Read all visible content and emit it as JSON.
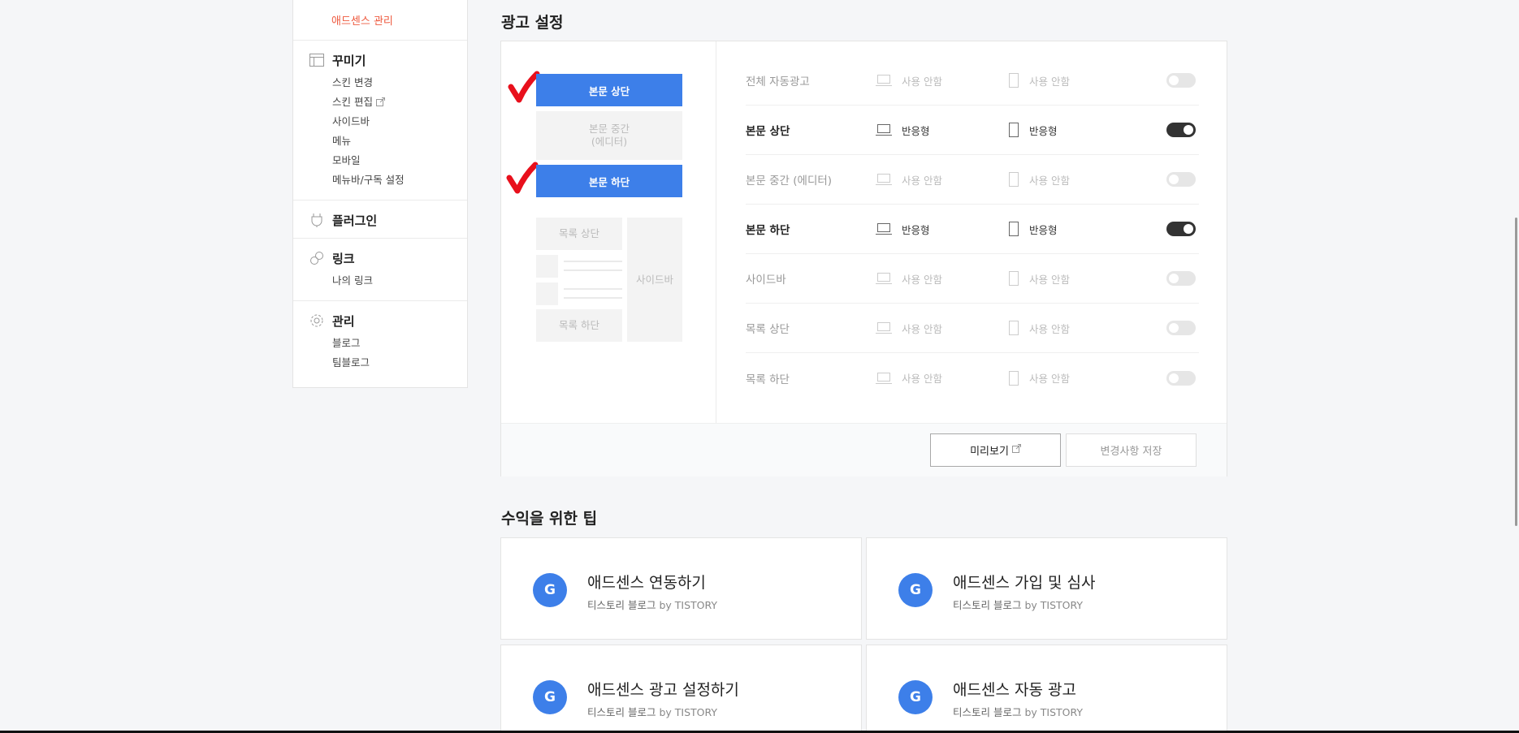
{
  "sidebar": {
    "active_item": "애드센스 관리",
    "groups": [
      {
        "title": "꾸미기",
        "icon": "layout-icon",
        "items": [
          "스킨 변경",
          "스킨 편집",
          "사이드바",
          "메뉴",
          "모바일",
          "메뉴바/구독 설정"
        ]
      },
      {
        "title": "플러그인",
        "icon": "plug-icon",
        "items": []
      },
      {
        "title": "링크",
        "icon": "link-icon",
        "items": [
          "나의 링크"
        ]
      },
      {
        "title": "관리",
        "icon": "gear-icon",
        "items": [
          "블로그",
          "팀블로그"
        ]
      }
    ]
  },
  "ad_settings": {
    "title": "광고 설정",
    "preview": {
      "body_top": "본문 상단",
      "body_mid_line1": "본문 중간",
      "body_mid_line2": "(에디터)",
      "body_bottom": "본문 하단",
      "list_top": "목록 상단",
      "list_bottom": "목록 하단",
      "sidebar": "사이드바"
    },
    "rows": [
      {
        "name": "전체 자동광고",
        "pc": "사용 안함",
        "mobile": "사용 안함",
        "enabled": false
      },
      {
        "name": "본문 상단",
        "pc": "반응형",
        "mobile": "반응형",
        "enabled": true
      },
      {
        "name": "본문 중간 (에디터)",
        "pc": "사용 안함",
        "mobile": "사용 안함",
        "enabled": false
      },
      {
        "name": "본문 하단",
        "pc": "반응형",
        "mobile": "반응형",
        "enabled": true
      },
      {
        "name": "사이드바",
        "pc": "사용 안함",
        "mobile": "사용 안함",
        "enabled": false
      },
      {
        "name": "목록 상단",
        "pc": "사용 안함",
        "mobile": "사용 안함",
        "enabled": false
      },
      {
        "name": "목록 하단",
        "pc": "사용 안함",
        "mobile": "사용 안함",
        "enabled": false
      }
    ],
    "preview_button": "미리보기",
    "save_button": "변경사항 저장"
  },
  "tips": {
    "title": "수익을 위한 팁",
    "cards": [
      {
        "logo": "G",
        "title": "애드센스 연동하기",
        "source": "티스토리 블로그",
        "by": "by TISTORY"
      },
      {
        "logo": "G",
        "title": "애드센스 가입 및 심사",
        "source": "티스토리 블로그",
        "by": "by TISTORY"
      },
      {
        "logo": "G",
        "title": "애드센스 광고 설정하기",
        "source": "티스토리 블로그",
        "by": "by TISTORY"
      },
      {
        "logo": "G",
        "title": "애드센스 자동 광고",
        "source": "티스토리 블로그",
        "by": "by TISTORY"
      }
    ]
  },
  "colors": {
    "accent": "#3d7fe9",
    "active_menu": "#ee5a3f",
    "check_mark": "#e8101c"
  }
}
